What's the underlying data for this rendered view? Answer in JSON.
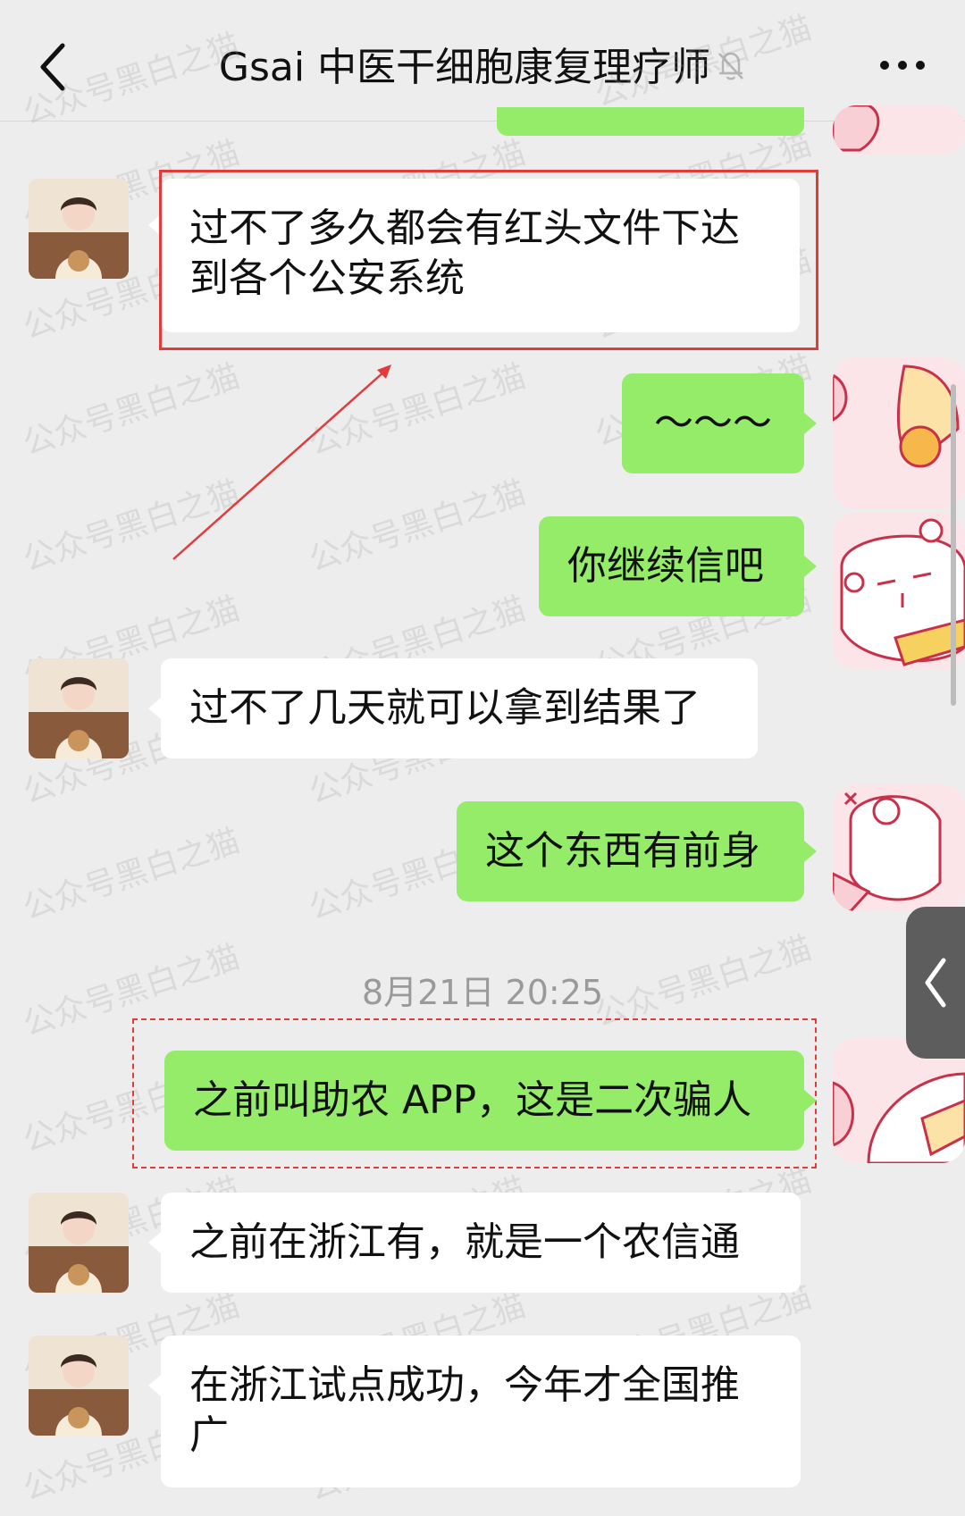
{
  "header": {
    "title": "Gsai 中医干细胞康复理疗师",
    "muted": true
  },
  "messages": [
    {
      "side": "left",
      "text": "过不了多久都会有红头文件下达到各个公安系统"
    },
    {
      "side": "right",
      "text": "～～～"
    },
    {
      "side": "right",
      "text": "你继续信吧"
    },
    {
      "side": "left",
      "text": "过不了几天就可以拿到结果了"
    },
    {
      "side": "right",
      "text": "这个东西有前身"
    },
    {
      "side": "right",
      "text": "之前叫助农 APP，这是二次骗人"
    },
    {
      "side": "left",
      "text": "之前在浙江有，就是一个农信通"
    },
    {
      "side": "left",
      "text": "在浙江试点成功，今年才全国推广"
    }
  ],
  "timestamp": "8月21日 20:25",
  "watermark_text": "公众号黑白之猫",
  "colors": {
    "background": "#ededed",
    "sent_bubble": "#95ec69",
    "received_bubble": "#ffffff",
    "annotation": "#e23b3b"
  },
  "icons": {
    "back": "chevron-left-icon",
    "mute": "bell-slash-icon",
    "more": "more-dots-icon",
    "side_tab": "chevron-left-icon"
  }
}
